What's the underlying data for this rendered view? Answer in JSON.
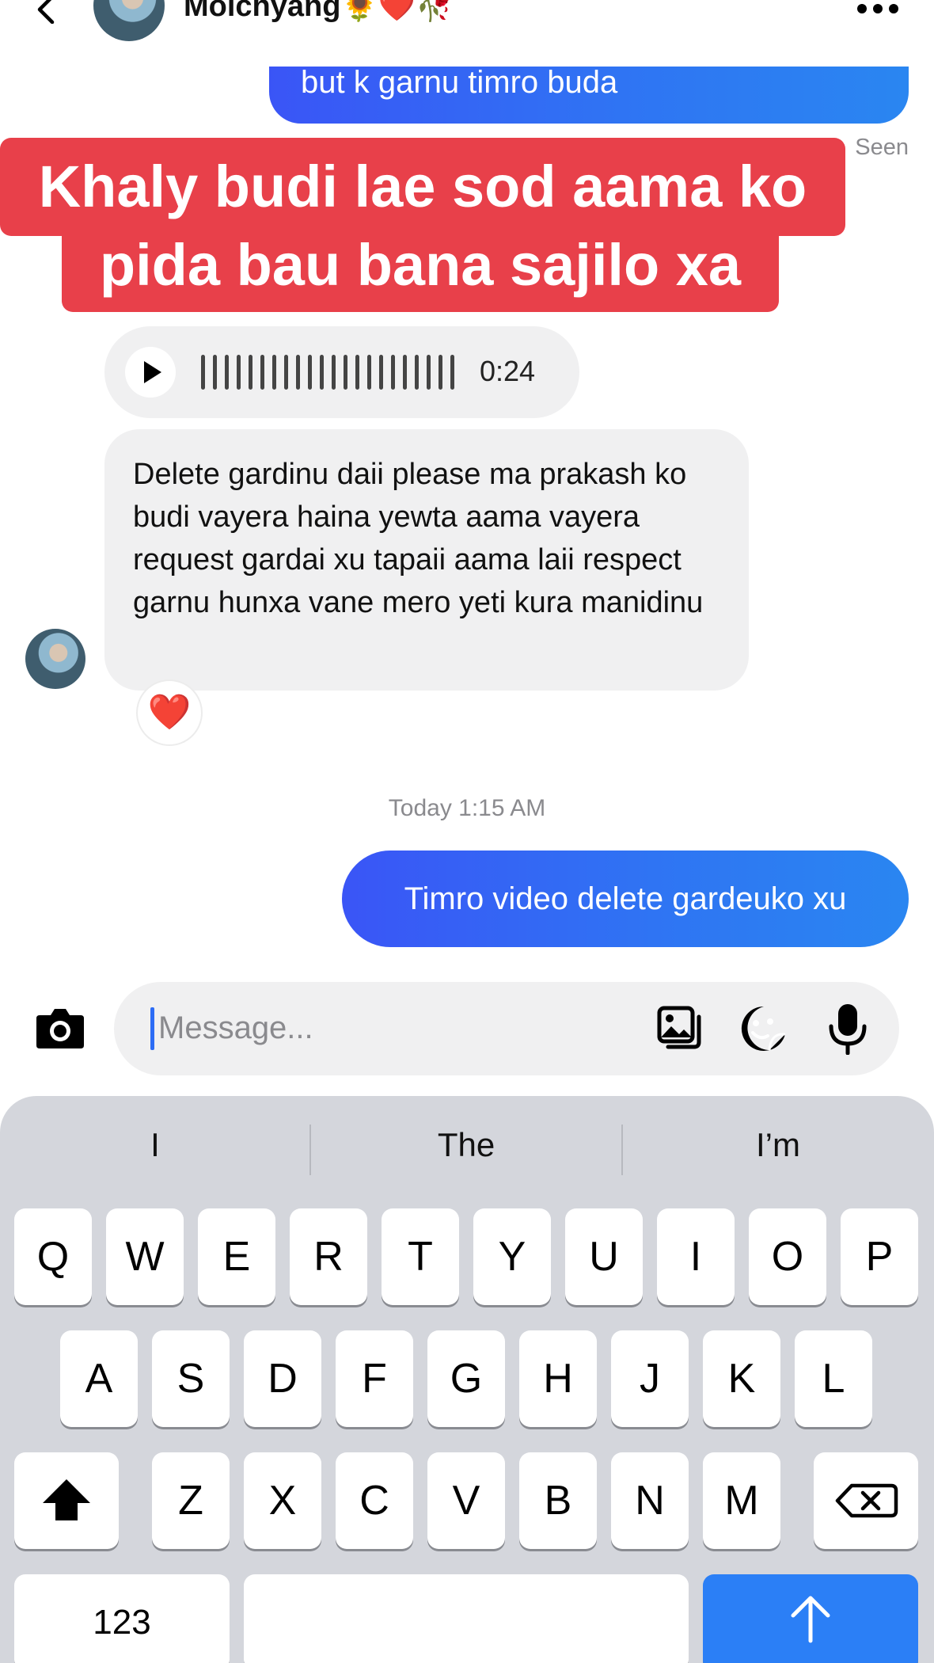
{
  "header": {
    "contact_name": "Moichyang🌻❤️🥀"
  },
  "messages": {
    "outgoing_top": "but k garnu timro buda",
    "seen_label": "Seen",
    "caption_line1": "Khaly budi lae sod aama ko",
    "caption_line2": "pida bau bana sajilo xa",
    "voice_duration": "0:24",
    "incoming_text": "Delete gardinu daii please ma prakash ko budi vayera haina yewta aama vayera request gardai xu tapaii aama laii respect garnu hunxa vane mero yeti kura manidinu",
    "reaction": "❤️",
    "timestamp": "Today 1:15 AM",
    "outgoing_last": "Timro video delete gardeuko xu"
  },
  "composer": {
    "placeholder": "Message..."
  },
  "keyboard": {
    "suggestions": [
      "I",
      "The",
      "I’m"
    ],
    "row1": [
      "Q",
      "W",
      "E",
      "R",
      "T",
      "Y",
      "U",
      "I",
      "O",
      "P"
    ],
    "row2": [
      "A",
      "S",
      "D",
      "F",
      "G",
      "H",
      "J",
      "K",
      "L"
    ],
    "row3": [
      "Z",
      "X",
      "C",
      "V",
      "B",
      "N",
      "M"
    ],
    "numbers_key": "123"
  },
  "colors": {
    "accent_blue": "#2f74f3",
    "caption_red": "#e8404a",
    "keyboard_bg": "#d4d6dc"
  }
}
